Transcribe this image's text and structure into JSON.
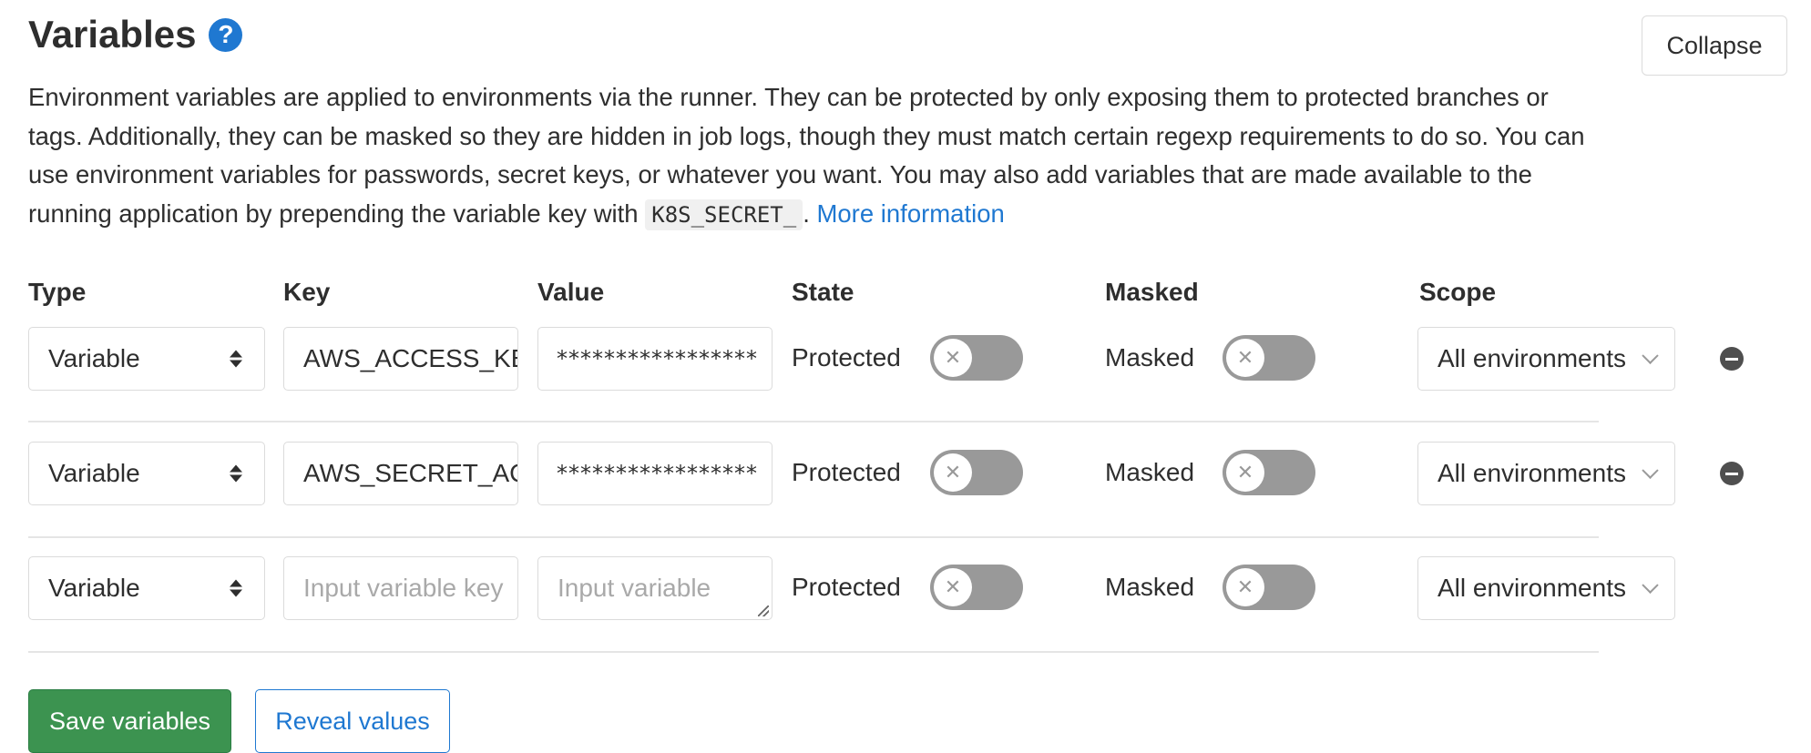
{
  "header": {
    "title": "Variables",
    "help_icon_glyph": "?",
    "collapse_label": "Collapse"
  },
  "description": {
    "text_before_code": "Environment variables are applied to environments via the runner. They can be protected by only exposing them to protected branches or tags. Additionally, they can be masked so they are hidden in job logs, though they must match certain regexp requirements to do so. You can use environment variables for passwords, secret keys, or whatever you want. You may also add variables that are made available to the running application by prepending the variable key with",
    "code": "K8S_SECRET_",
    "text_after_code": ".",
    "link_text": "More information"
  },
  "columns": {
    "type": "Type",
    "key": "Key",
    "value": "Value",
    "state": "State",
    "masked": "Masked",
    "scope": "Scope"
  },
  "rows": [
    {
      "type": "Variable",
      "key": "AWS_ACCESS_KE",
      "value": "*****************",
      "state_label": "Protected",
      "protected": false,
      "masked_label": "Masked",
      "masked": false,
      "scope": "All environments",
      "removable": true
    },
    {
      "type": "Variable",
      "key": "AWS_SECRET_AC",
      "value": "*****************",
      "state_label": "Protected",
      "protected": false,
      "masked_label": "Masked",
      "masked": false,
      "scope": "All environments",
      "removable": true
    },
    {
      "type": "Variable",
      "key_placeholder": "Input variable key",
      "value_placeholder": "Input variable",
      "state_label": "Protected",
      "protected": false,
      "masked_label": "Masked",
      "masked": false,
      "scope": "All environments",
      "removable": false
    }
  ],
  "toggle_off_glyph": "✕",
  "actions": {
    "save_label": "Save variables",
    "reveal_label": "Reveal values"
  },
  "colors": {
    "accent_blue": "#1f78d1",
    "save_green": "#3c9350",
    "toggle_off": "#999999"
  }
}
